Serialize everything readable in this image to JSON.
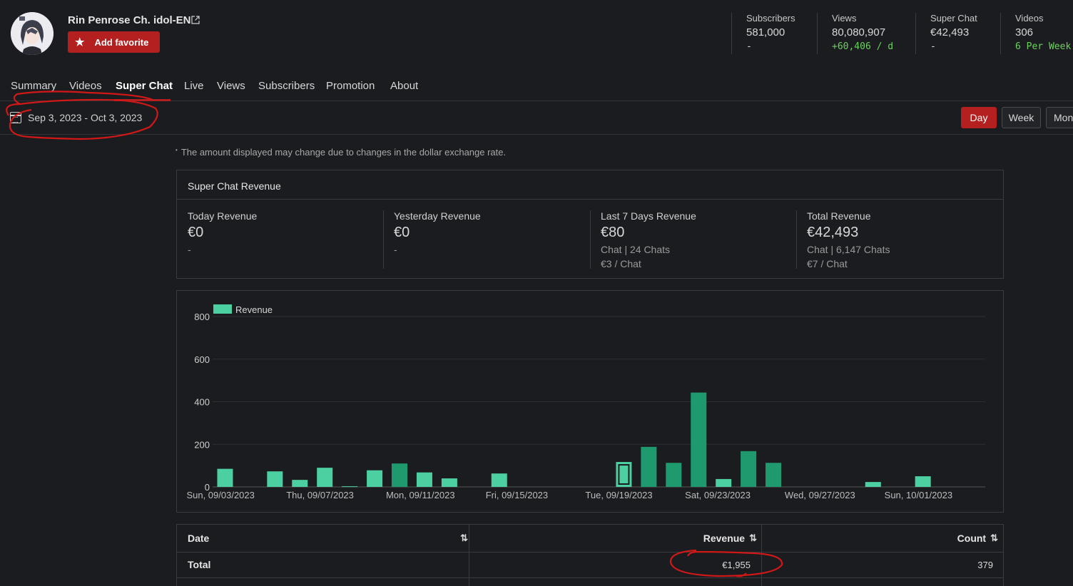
{
  "channel": {
    "name": "Rin Penrose Ch. idol-EN",
    "favorite_label": "Add favorite"
  },
  "stats": [
    {
      "label": "Subscribers",
      "value": "581,000",
      "sub": "-",
      "sub_color": "normal"
    },
    {
      "label": "Views",
      "value": "80,080,907",
      "sub": "+60,406 / d",
      "sub_color": "green"
    },
    {
      "label": "Super Chat",
      "value": "€42,493",
      "sub": "-",
      "sub_color": "normal"
    },
    {
      "label": "Videos",
      "value": "306",
      "sub": "6 Per Week",
      "sub_color": "green"
    }
  ],
  "tabs": [
    "Summary",
    "Videos",
    "Super Chat",
    "Live",
    "Views",
    "Subscribers",
    "Promotion",
    "About"
  ],
  "active_tab": "Super Chat",
  "date_range": "Sep 3, 2023 - Oct 3, 2023",
  "period_buttons": {
    "day": "Day",
    "week": "Week",
    "month": "Mon"
  },
  "note": "The amount displayed may change due to changes in the dollar exchange rate.",
  "revenue_card": {
    "title": "Super Chat Revenue",
    "columns": [
      {
        "label": "Today Revenue",
        "value": "€0",
        "line1": "-",
        "line2": ""
      },
      {
        "label": "Yesterday Revenue",
        "value": "€0",
        "line1": "-",
        "line2": ""
      },
      {
        "label": "Last 7 Days Revenue",
        "value": "€80",
        "line1": "Chat | 24 Chats",
        "line2": "€3 / Chat"
      },
      {
        "label": "Total Revenue",
        "value": "€42,493",
        "line1": "Chat | 6,147 Chats",
        "line2": "€7 / Chat"
      }
    ]
  },
  "chart_data": {
    "type": "bar",
    "legend": [
      "Revenue"
    ],
    "ylim": [
      0,
      800
    ],
    "yticks": [
      0,
      200,
      400,
      600,
      800
    ],
    "grid": true,
    "legend_position": "top-left",
    "colors": {
      "light": "#4dd0a1",
      "dark": "#1e9a6e"
    },
    "x_tick_labels": [
      "Sun, 09/03/2023",
      "Thu, 09/07/2023",
      "Mon, 09/11/2023",
      "Fri, 09/15/2023",
      "Tue, 09/19/2023",
      "Sat, 09/23/2023",
      "Wed, 09/27/2023",
      "Sun, 10/01/2023"
    ],
    "categories": [
      "09/03",
      "09/04",
      "09/05",
      "09/06",
      "09/07",
      "09/08",
      "09/09",
      "09/10",
      "09/11",
      "09/12",
      "09/13",
      "09/14",
      "09/15",
      "09/16",
      "09/17",
      "09/18",
      "09/19",
      "09/20",
      "09/21",
      "09/22",
      "09/23",
      "09/24",
      "09/25",
      "09/26",
      "09/27",
      "09/28",
      "09/29",
      "09/30",
      "10/01",
      "10/02",
      "10/03"
    ],
    "values": [
      85,
      0,
      73,
      33,
      90,
      3,
      78,
      110,
      68,
      40,
      0,
      63,
      0,
      0,
      0,
      0,
      117,
      188,
      113,
      443,
      37,
      168,
      113,
      0,
      0,
      0,
      23,
      0,
      50,
      0,
      0
    ],
    "shade": [
      "light",
      "light",
      "light",
      "light",
      "light",
      "light",
      "light",
      "dark",
      "light",
      "light",
      "light",
      "light",
      "light",
      "light",
      "light",
      "light",
      "light",
      "dark",
      "dark",
      "dark",
      "light",
      "dark",
      "dark",
      "light",
      "light",
      "light",
      "light",
      "light",
      "light",
      "light",
      "light"
    ],
    "highlighted_index": 16
  },
  "table": {
    "headers": {
      "date": "Date",
      "revenue": "Revenue",
      "count": "Count"
    },
    "sort_icon": "⇅",
    "total_row": {
      "label": "Total",
      "revenue": "€1,955",
      "count": "379"
    }
  }
}
